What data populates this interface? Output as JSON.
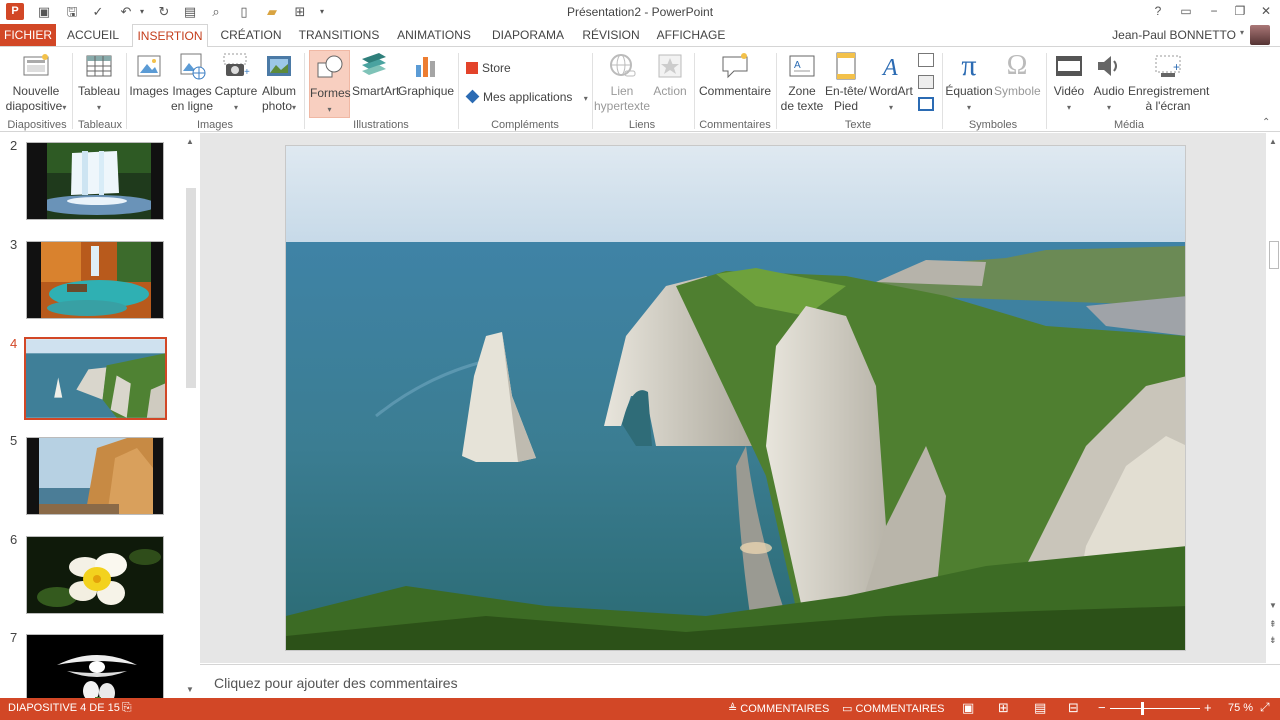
{
  "title_bar": {
    "app_icon_letter": "P",
    "document_title": "Présentation2 - PowerPoint",
    "help": "?",
    "restore_ribbon": "▭",
    "minimize": "−",
    "maximize": "❐",
    "close": "✕"
  },
  "tabs": {
    "file": "FICHIER",
    "items": [
      "ACCUEIL",
      "INSERTION",
      "CRÉATION",
      "TRANSITIONS",
      "ANIMATIONS",
      "DIAPORAMA",
      "RÉVISION",
      "AFFICHAGE"
    ],
    "active": "INSERTION"
  },
  "user": {
    "name": "Jean-Paul BONNETTO"
  },
  "ribbon": {
    "groups": {
      "slides": "Diapositives",
      "tables": "Tableaux",
      "images": "Images",
      "illustrations": "Illustrations",
      "addins": "Compléments",
      "links": "Liens",
      "comments": "Commentaires",
      "text": "Texte",
      "symbols": "Symboles",
      "media": "Média"
    },
    "buttons": {
      "new_slide_1": "Nouvelle",
      "new_slide_2": "diapositive",
      "table": "Tableau",
      "images": "Images",
      "online_images_1": "Images",
      "online_images_2": "en ligne",
      "capture": "Capture",
      "album_1": "Album",
      "album_2": "photo",
      "shapes": "Formes",
      "smartart": "SmartArt",
      "chart": "Graphique",
      "store": "Store",
      "my_apps": "Mes applications",
      "link_1": "Lien",
      "link_2": "hypertexte",
      "action": "Action",
      "comment": "Commentaire",
      "textbox_1": "Zone",
      "textbox_2": "de texte",
      "header_1": "En-tête/",
      "header_2": "Pied",
      "wordart": "WordArt",
      "equation": "Équation",
      "symbol": "Symbole",
      "video": "Vidéo",
      "audio": "Audio",
      "record_1": "Enregistrement",
      "record_2": "à l'écran"
    }
  },
  "slides_panel": {
    "thumbs": [
      {
        "num": "2"
      },
      {
        "num": "3"
      },
      {
        "num": "4"
      },
      {
        "num": "5"
      },
      {
        "num": "6"
      },
      {
        "num": "7"
      }
    ]
  },
  "notes": {
    "placeholder": "Cliquez pour ajouter des commentaires"
  },
  "status": {
    "slide_info": "DIAPOSITIVE 4 DE 15",
    "notes_btn": "COMMENTAIRES",
    "comments_btn": "COMMENTAIRES",
    "zoom": "75 %",
    "zoom_level": 0.75
  },
  "colors": {
    "accent": "#d24726",
    "active_tab_text": "#c43e1c"
  }
}
